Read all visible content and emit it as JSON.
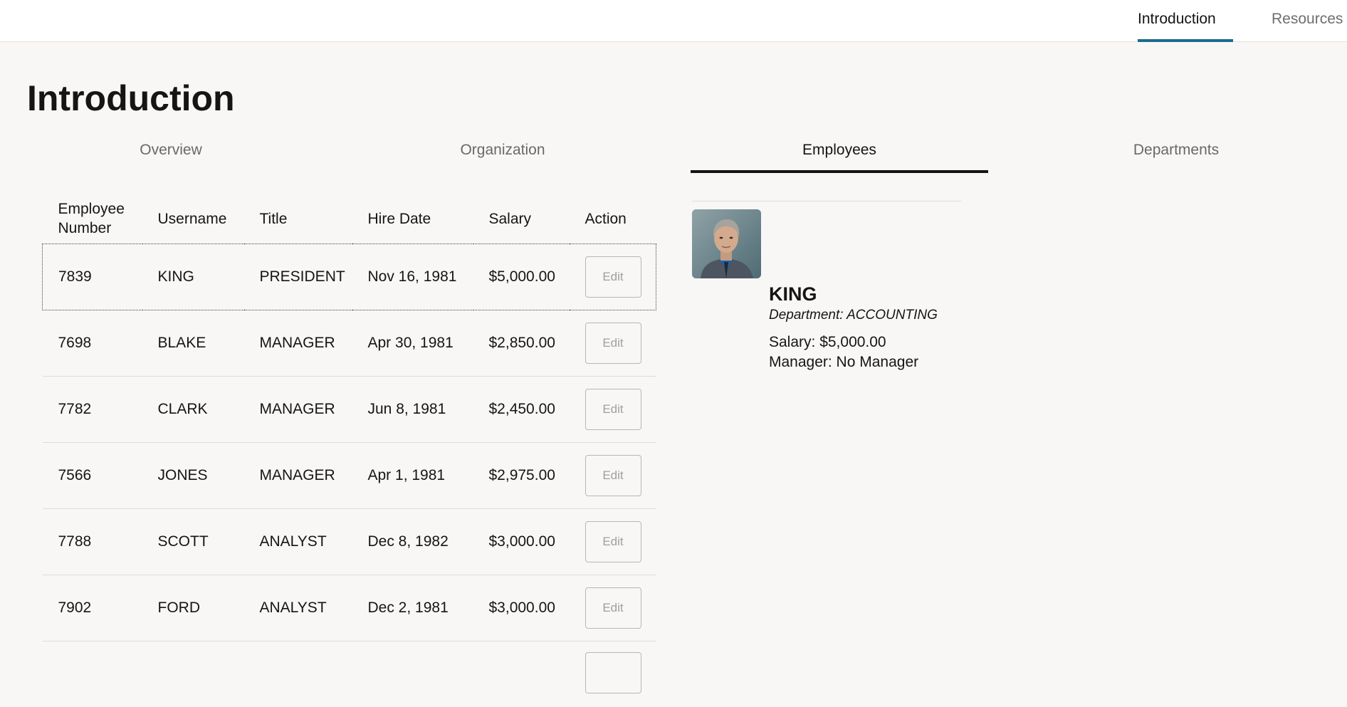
{
  "topnav": {
    "items": [
      {
        "label": "Introduction",
        "active": true
      },
      {
        "label": "Resources",
        "active": false
      }
    ],
    "active_color": "#1a6b8c"
  },
  "page_title": "Introduction",
  "tabs": [
    {
      "label": "Overview",
      "active": false
    },
    {
      "label": "Organization",
      "active": false
    },
    {
      "label": "Employees",
      "active": true
    },
    {
      "label": "Departments",
      "active": false
    }
  ],
  "table": {
    "columns": [
      "Employee Number",
      "Username",
      "Title",
      "Hire Date",
      "Salary",
      "Action"
    ],
    "edit_label": "Edit",
    "rows": [
      {
        "number": "7839",
        "username": "KING",
        "title": "PRESIDENT",
        "hire_date": "Nov 16, 1981",
        "salary": "$5,000.00",
        "selected": true
      },
      {
        "number": "7698",
        "username": "BLAKE",
        "title": "MANAGER",
        "hire_date": "Apr 30, 1981",
        "salary": "$2,850.00",
        "selected": false
      },
      {
        "number": "7782",
        "username": "CLARK",
        "title": "MANAGER",
        "hire_date": "Jun 8, 1981",
        "salary": "$2,450.00",
        "selected": false
      },
      {
        "number": "7566",
        "username": "JONES",
        "title": "MANAGER",
        "hire_date": "Apr 1, 1981",
        "salary": "$2,975.00",
        "selected": false
      },
      {
        "number": "7788",
        "username": "SCOTT",
        "title": "ANALYST",
        "hire_date": "Dec 8, 1982",
        "salary": "$3,000.00",
        "selected": false
      },
      {
        "number": "7902",
        "username": "FORD",
        "title": "ANALYST",
        "hire_date": "Dec 2, 1981",
        "salary": "$3,000.00",
        "selected": false
      }
    ]
  },
  "detail": {
    "name": "KING",
    "department": "Department: ACCOUNTING",
    "salary": "Salary: $5,000.00",
    "manager": "Manager: No Manager"
  }
}
